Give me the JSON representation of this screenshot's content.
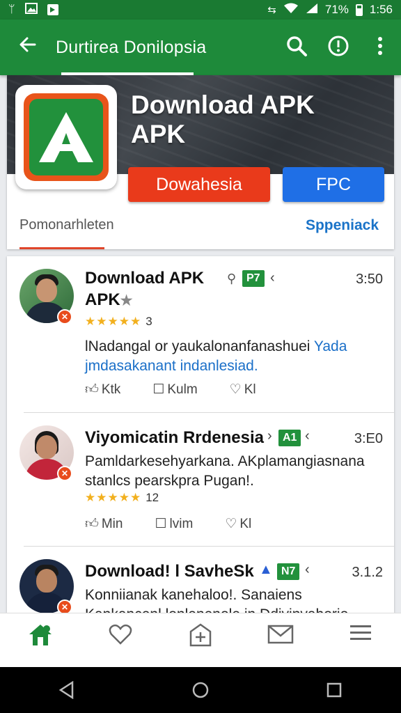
{
  "status_bar": {
    "battery": "71%",
    "time": "1:56"
  },
  "app_bar": {
    "title": "Durtirea Donilopsia"
  },
  "banner": {
    "app_title_line1": "Download APK",
    "app_title_line2": "APK",
    "primary_button": "Dowahesia",
    "secondary_button": "FPC",
    "tab_left": "Pomonarhleten",
    "tab_right": "Sppeniack"
  },
  "posts": [
    {
      "title_line1": "Download APK",
      "title_line2": "APK",
      "tag": "P7",
      "time": "3:50",
      "rating_stars": "★★★★★",
      "rating_count": "3",
      "text_line1": "lNadangal or yaukalonanfanashuei",
      "text_link": "Yada",
      "text_line2": "jmdasakanant indanlesiad.",
      "action1": "Ktk",
      "action2": "Kulm",
      "action3": "Kl"
    },
    {
      "title": "Viyomicatin Rrdenesia",
      "tag": "A1",
      "time": "3:E0",
      "text_line1": "Pamldarkesehyarkana. AKplamangiasnana",
      "text_line2": "stanlcs pearskpra Pugan!.",
      "rating_stars": "★★★★★",
      "rating_count": "12",
      "action1": "Min",
      "action2": "lvim",
      "action3": "Kl"
    },
    {
      "title": "Download! l SavheSk",
      "tag": "N7",
      "time": "3.1.2",
      "text_line1": "Konniianak kanehaloo!. Sanaiens",
      "text_line2": "Kankancenl lonlenenole in Ddiyinvahorio"
    }
  ],
  "colors": {
    "accent_green": "#1e8a3a",
    "red_button": "#e93a1b",
    "blue_button": "#1f6fe6",
    "star": "#f2b01e"
  },
  "icons": [
    "back-arrow-icon",
    "search-icon",
    "info-icon",
    "more-vert-icon",
    "home-icon",
    "heart-icon",
    "add-box-icon",
    "mail-icon",
    "menu-icon"
  ]
}
